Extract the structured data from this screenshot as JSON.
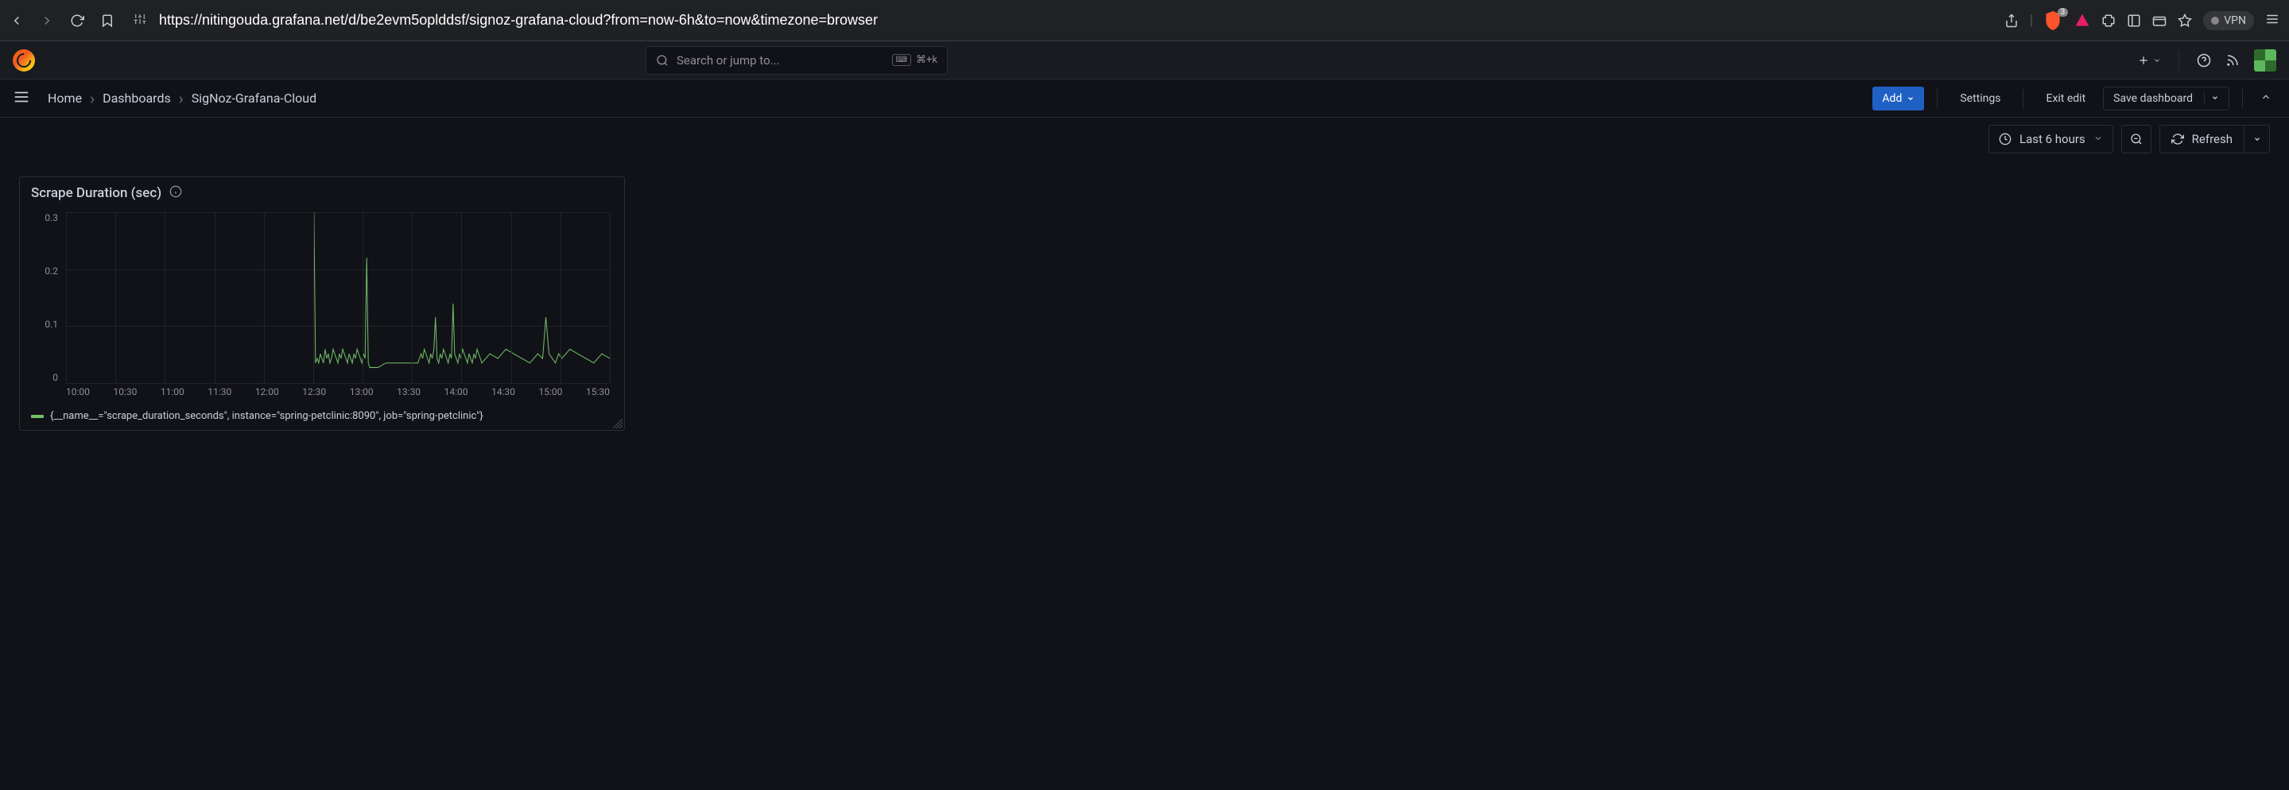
{
  "browser": {
    "url": "https://nitingouda.grafana.net/d/be2evm5oplddsf/signoz-grafana-cloud?from=now-6h&to=now&timezone=browser",
    "brave_count": "3",
    "vpn_label": "VPN"
  },
  "topnav": {
    "search_placeholder": "Search or jump to...",
    "shortcut": "⌘+k"
  },
  "breadcrumbs": {
    "home": "Home",
    "dashboards": "Dashboards",
    "current": "SigNoz-Grafana-Cloud"
  },
  "actions": {
    "add": "Add",
    "settings": "Settings",
    "exit_edit": "Exit edit",
    "save": "Save dashboard"
  },
  "toolbar": {
    "time_range": "Last 6 hours",
    "refresh": "Refresh"
  },
  "panel": {
    "title": "Scrape Duration (sec)",
    "legend": "{__name__=\"scrape_duration_seconds\", instance=\"spring-petclinic:8090\", job=\"spring-petclinic\"}"
  },
  "chart_data": {
    "type": "line",
    "title": "Scrape Duration (sec)",
    "xlabel": "",
    "ylabel": "",
    "ylim": [
      0,
      0.35
    ],
    "y_ticks": [
      "0.3",
      "0.2",
      "0.1",
      "0"
    ],
    "x_ticks": [
      "10:00",
      "10:30",
      "11:00",
      "11:30",
      "12:00",
      "12:30",
      "13:00",
      "13:30",
      "14:00",
      "14:30",
      "15:00",
      "15:30"
    ],
    "series": [
      {
        "name": "{__name__=\"scrape_duration_seconds\", instance=\"spring-petclinic:8090\", job=\"spring-petclinic\"}",
        "color": "#73bf69",
        "x": [
          "12:35",
          "12:36",
          "12:37",
          "12:38",
          "12:39",
          "12:40",
          "12:41",
          "12:42",
          "12:43",
          "12:44",
          "12:45",
          "12:46",
          "12:47",
          "12:48",
          "12:49",
          "12:50",
          "12:51",
          "12:52",
          "12:53",
          "12:54",
          "12:55",
          "12:56",
          "12:57",
          "12:58",
          "12:59",
          "13:00",
          "13:01",
          "13:02",
          "13:03",
          "13:04",
          "13:05",
          "13:06",
          "13:07",
          "13:08",
          "13:09",
          "13:10",
          "13:15",
          "13:20",
          "13:40",
          "13:41",
          "13:42",
          "13:43",
          "13:44",
          "13:45",
          "13:46",
          "13:47",
          "13:48",
          "13:49",
          "13:50",
          "13:51",
          "13:52",
          "13:53",
          "13:54",
          "13:55",
          "13:56",
          "13:57",
          "13:58",
          "13:59",
          "14:00",
          "14:01",
          "14:02",
          "14:03",
          "14:04",
          "14:05",
          "14:06",
          "14:07",
          "14:08",
          "14:09",
          "14:10",
          "14:11",
          "14:12",
          "14:13",
          "14:14",
          "14:15",
          "14:16",
          "14:17",
          "14:18",
          "14:19",
          "14:20",
          "14:25",
          "14:30",
          "14:35",
          "14:40",
          "14:45",
          "14:50",
          "14:55",
          "14:58",
          "15:00",
          "15:02",
          "15:04",
          "15:06",
          "15:08",
          "15:10",
          "15:15",
          "15:20",
          "15:25",
          "15:30",
          "15:35",
          "15:40"
        ],
        "values": [
          0.35,
          0.02,
          0.03,
          0.02,
          0.04,
          0.03,
          0.02,
          0.05,
          0.03,
          0.04,
          0.02,
          0.03,
          0.05,
          0.04,
          0.03,
          0.02,
          0.04,
          0.03,
          0.05,
          0.04,
          0.03,
          0.02,
          0.04,
          0.03,
          0.02,
          0.04,
          0.03,
          0.05,
          0.04,
          0.03,
          0.02,
          0.04,
          0.03,
          0.25,
          0.02,
          0.01,
          0.01,
          0.02,
          0.02,
          0.03,
          0.04,
          0.03,
          0.05,
          0.04,
          0.03,
          0.02,
          0.04,
          0.03,
          0.05,
          0.12,
          0.03,
          0.02,
          0.04,
          0.03,
          0.05,
          0.04,
          0.03,
          0.02,
          0.04,
          0.03,
          0.15,
          0.04,
          0.03,
          0.02,
          0.04,
          0.03,
          0.05,
          0.04,
          0.03,
          0.02,
          0.04,
          0.03,
          0.02,
          0.04,
          0.03,
          0.05,
          0.04,
          0.03,
          0.02,
          0.04,
          0.03,
          0.05,
          0.04,
          0.03,
          0.02,
          0.04,
          0.03,
          0.12,
          0.04,
          0.03,
          0.02,
          0.04,
          0.03,
          0.05,
          0.04,
          0.03,
          0.02,
          0.04,
          0.03
        ]
      }
    ]
  }
}
